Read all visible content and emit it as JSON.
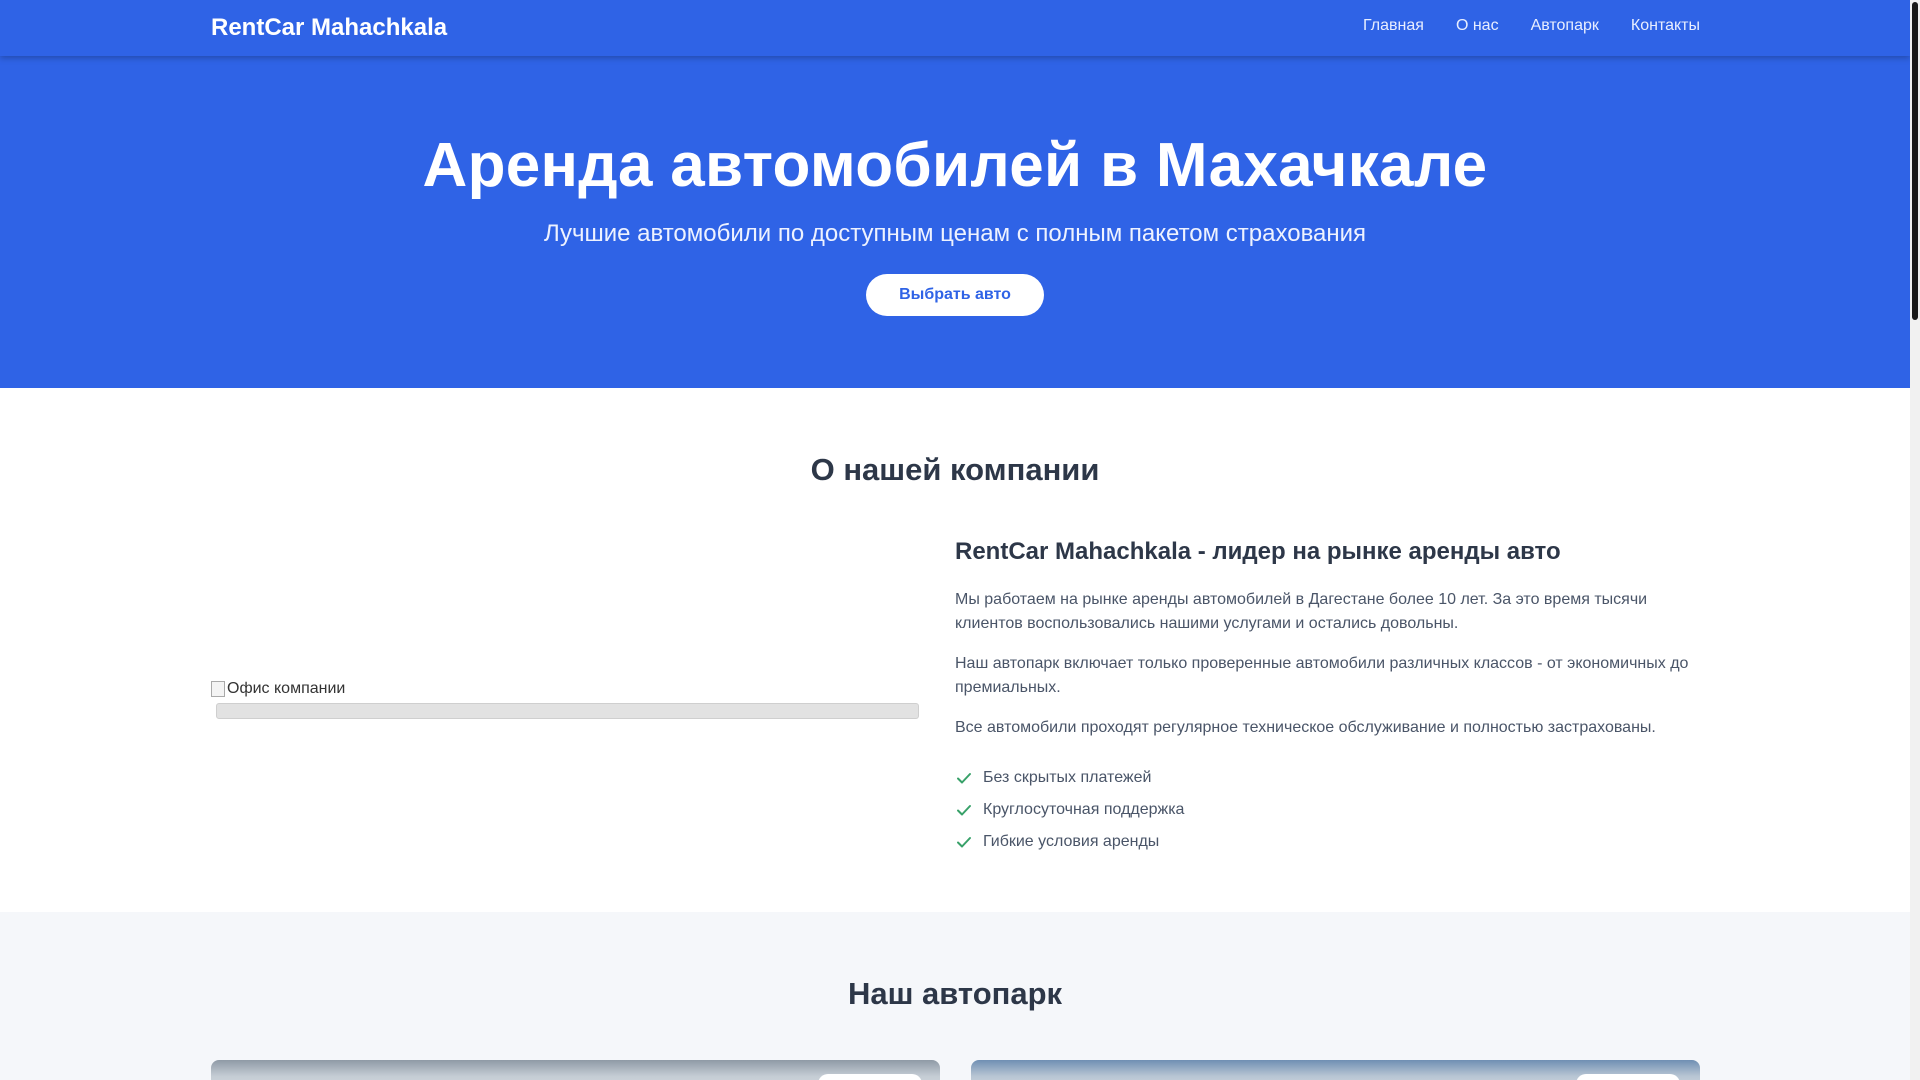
{
  "nav": {
    "brand": "RentCar Mahachkala",
    "links": [
      "Главная",
      "О нас",
      "Автопарк",
      "Контакты"
    ]
  },
  "hero": {
    "title": "Аренда автомобилей в Махачкале",
    "subtitle": "Лучшие автомобили по доступным ценам с полным пакетом страхования",
    "cta": "Выбрать авто"
  },
  "about": {
    "title": "О нашей компании",
    "image_alt": "Офис компании",
    "heading": "RentCar Mahachkala - лидер на рынке аренды авто",
    "paragraphs": [
      "Мы работаем на рынке аренды автомобилей в Дагестане более 10 лет. За это время тысячи клиентов воспользовались нашими услугами и остались довольны.",
      "Наш автопарк включает только проверенные автомобили различных классов - от экономичных до премиальных.",
      "Все автомобили проходят регулярное техническое обслуживание и полностью застрахованы."
    ],
    "features": [
      "Без скрытых платежей",
      "Круглосуточная поддержка",
      "Гибкие условия аренды"
    ]
  },
  "fleet": {
    "title": "Наш автопарк"
  },
  "colors": {
    "primary": "#2f63e6",
    "check": "#38a169",
    "heading": "#2d3748",
    "body": "#4a5568"
  }
}
